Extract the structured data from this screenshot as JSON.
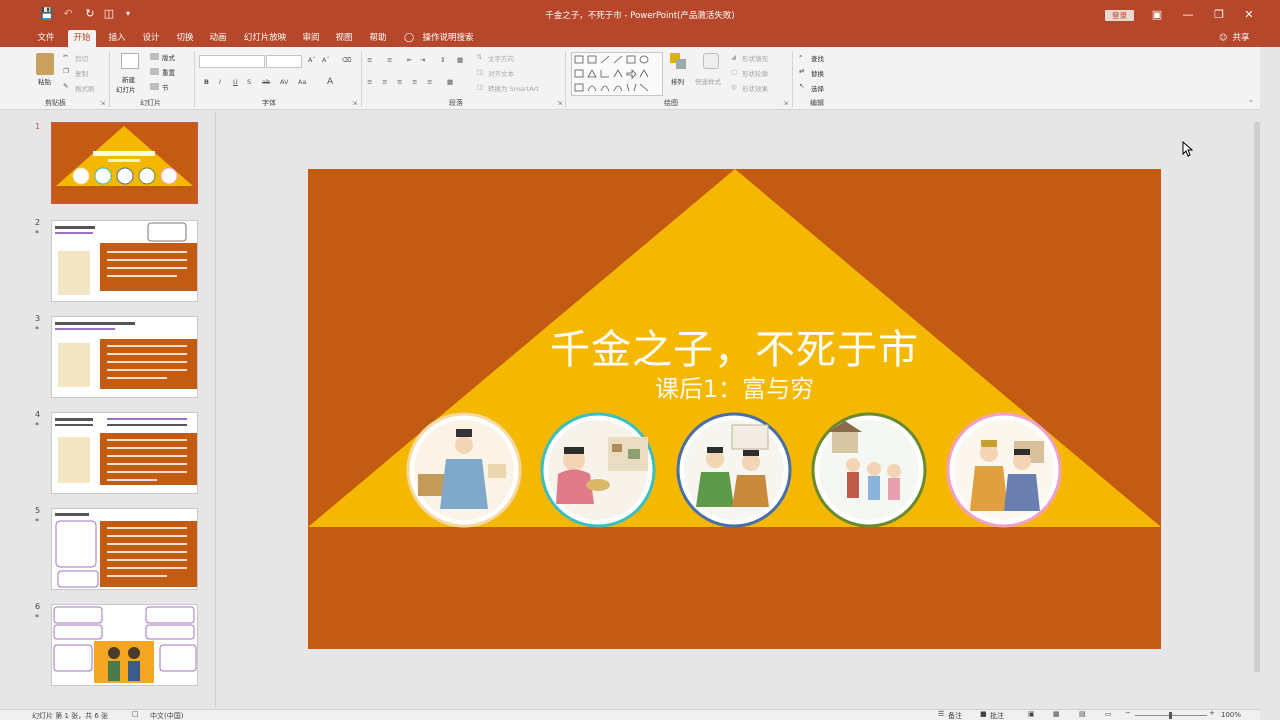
{
  "window": {
    "title": "千金之子，不死于市 - PowerPoint(产品激活失败)",
    "signin_label": "登录"
  },
  "tabs": {
    "items": [
      "文件",
      "开始",
      "插入",
      "设计",
      "切换",
      "动画",
      "幻灯片放映",
      "审阅",
      "视图",
      "帮助"
    ],
    "active": "开始",
    "tell_me": "操作说明搜索",
    "share": "共享"
  },
  "ribbon": {
    "clipboard": {
      "paste": "粘贴",
      "cut": "剪切",
      "copy": "复制",
      "format_painter": "格式刷",
      "label": "剪贴板"
    },
    "slides": {
      "new_slide_1": "新建",
      "new_slide_2": "幻灯片",
      "layout": "版式",
      "reset": "重置",
      "section": "节",
      "label": "幻灯片"
    },
    "font": {
      "label": "字体"
    },
    "paragraph": {
      "text_direction": "文字方向",
      "align_text": "对齐文本",
      "smartart": "转换为 SmartArt",
      "label": "段落"
    },
    "drawing": {
      "arrange": "排列",
      "quick_styles": "快速样式",
      "shape_fill": "形状填充",
      "shape_outline": "形状轮廓",
      "shape_effects": "形状效果",
      "label": "绘图"
    },
    "editing": {
      "find": "查找",
      "replace": "替换",
      "select": "选择",
      "label": "编辑"
    }
  },
  "thumbnails": {
    "numbers": [
      "1",
      "2",
      "3",
      "4",
      "5",
      "6"
    ],
    "star": "*"
  },
  "slide": {
    "title": "千金之子，不死于市",
    "subtitle": "课后1：富与穷",
    "bg_color": "#c35c12",
    "triangle_color": "#f5b800",
    "circle_rings": [
      "#f4d9a0",
      "#3bbfbf",
      "#4a6fa5",
      "#6a8a2e",
      "#f2a0c8"
    ]
  },
  "status": {
    "slide_info": "幻灯片 第 1 张，共 6 张",
    "language": "中文(中国)",
    "notes": "备注",
    "comments": "批注",
    "zoom": "100%"
  }
}
